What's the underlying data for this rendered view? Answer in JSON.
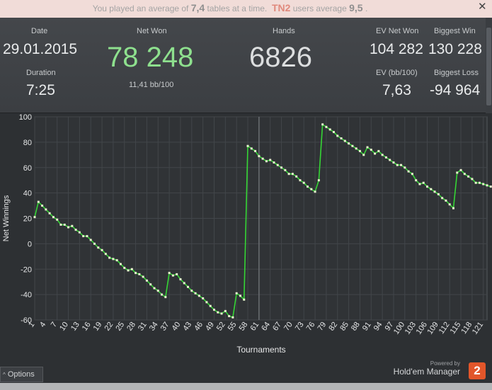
{
  "notice": {
    "part1": "You played an average of",
    "tables_avg": "7,4",
    "part2": "tables at a time.",
    "tn2": "TN2",
    "part3": "users average",
    "users_avg": "9,5",
    "part4": ".",
    "close_label": "✕"
  },
  "stats": {
    "date_label": "Date",
    "date_value": "29.01.2015",
    "duration_label": "Duration",
    "duration_value": "7:25",
    "netwon_label": "Net Won",
    "netwon_value": "78 248",
    "bb100_value": "11,41 bb/100",
    "hands_label": "Hands",
    "hands_value": "6826",
    "ev_net_won_label": "EV Net Won",
    "ev_net_won_value": "104 282",
    "biggest_win_label": "Biggest Win",
    "biggest_win_value": "130 228",
    "ev_bb_label": "EV (bb/100)",
    "ev_bb_value": "7,63",
    "biggest_loss_label": "Biggest Loss",
    "biggest_loss_value": "-94 964"
  },
  "colors": {
    "net_won": "#8ee08e",
    "line": "#35d635",
    "points": "#e8f2cf",
    "grid": "#42464a",
    "logo": "#e2562a"
  },
  "footer": {
    "options_label": "Options",
    "options_icon": "caret-up-icon",
    "powered_by": "Powered by",
    "brand_name": "Hold'em Manager",
    "logo_text": "2"
  },
  "chart_data": {
    "type": "line",
    "ylabel": "Net Winnings",
    "xlabel": "Tournaments",
    "ylim": [
      -60,
      100
    ],
    "yticks": [
      100,
      80,
      60,
      40,
      20,
      0,
      -20,
      -40,
      -60
    ],
    "xlim": [
      1,
      122
    ],
    "xticks": [
      1,
      4,
      7,
      10,
      13,
      16,
      19,
      22,
      25,
      28,
      31,
      34,
      37,
      40,
      43,
      46,
      49,
      52,
      55,
      58,
      61,
      64,
      67,
      70,
      73,
      76,
      79,
      82,
      85,
      88,
      91,
      94,
      97,
      100,
      103,
      106,
      109,
      112,
      115,
      118,
      121
    ],
    "grid": true,
    "vline_x": 61,
    "series": [
      {
        "values": [
          21,
          33,
          30,
          27,
          24,
          21,
          19,
          15,
          15,
          13,
          14,
          11,
          9,
          6,
          6,
          3,
          0,
          -3,
          -5,
          -8,
          -11,
          -12,
          -13,
          -16,
          -19,
          -21,
          -20,
          -23,
          -24,
          -26,
          -29,
          -32,
          -35,
          -37,
          -40,
          -42,
          -23,
          -25,
          -24,
          -28,
          -31,
          -34,
          -37,
          -39,
          -41,
          -43,
          -46,
          -49,
          -52,
          -54,
          -55,
          -53,
          -57,
          -58,
          -39,
          -41,
          -44,
          77,
          75,
          73,
          69,
          67,
          65,
          66,
          64,
          62,
          60,
          58,
          55,
          55,
          53,
          50,
          48,
          45,
          43,
          41,
          50,
          94,
          92,
          90,
          88,
          85,
          83,
          81,
          79,
          77,
          75,
          73,
          70,
          76,
          74,
          71,
          73,
          70,
          68,
          66,
          64,
          62,
          62,
          60,
          57,
          55,
          50,
          47,
          48,
          45,
          43,
          41,
          39,
          36,
          34,
          31,
          28,
          56,
          58,
          55,
          53,
          51,
          48,
          48,
          47,
          46,
          45
        ]
      }
    ]
  }
}
